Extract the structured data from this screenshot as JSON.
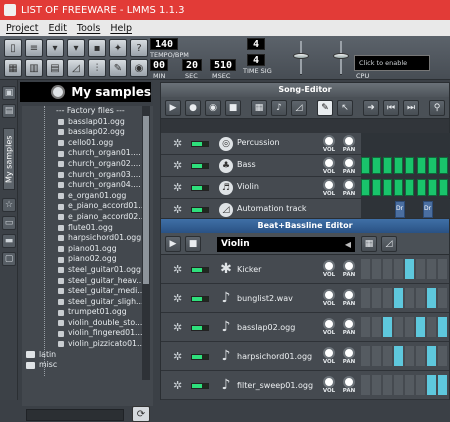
{
  "window": {
    "title": "LIST OF FREEWARE - LMMS 1.1.3"
  },
  "menu": [
    "Project",
    "Edit",
    "Tools",
    "Help"
  ],
  "toolbar": {
    "tempo_label": "TEMPO/BPM",
    "tempo_value": "140",
    "min_label": "MIN",
    "min_value": "00",
    "sec_label": "SEC",
    "sec_value": "20",
    "msec_label": "MSEC",
    "msec_value": "510",
    "timesig_label": "TIME SIG",
    "timesig_top": "4",
    "timesig_bottom": "4",
    "cpu_text": "Click to enable",
    "cpu_label": "CPU"
  },
  "sidebar": {
    "tab_label": "My samples"
  },
  "browser": {
    "title": "My samples",
    "header_row": "--- Factory files ---",
    "files": [
      "basslap01.ogg",
      "basslap02.ogg",
      "cello01.ogg",
      "church_organ01....",
      "church_organ02....",
      "church_organ03....",
      "church_organ04....",
      "e_organ01.ogg",
      "e_piano_accord01...",
      "e_piano_accord02...",
      "flute01.ogg",
      "harpsichord01.ogg",
      "piano01.ogg",
      "piano02.ogg",
      "steel_guitar01.ogg",
      "steel_guitar_heav...",
      "steel_guitar_medi...",
      "steel_guitar_sligh...",
      "trumpet01.ogg",
      "violin_double_sto...",
      "violin_fingered01...",
      "violin_pizzicato01..."
    ],
    "folders": [
      "latin",
      "misc"
    ]
  },
  "song_editor": {
    "title": "Song-Editor",
    "vol_label": "VOL",
    "pan_label": "PAN",
    "tracks": [
      {
        "name": "Percussion",
        "icon": "percussion-icon"
      },
      {
        "name": "Bass",
        "icon": "bass-icon"
      },
      {
        "name": "Violin",
        "icon": "violin-icon"
      },
      {
        "name": "Automation track",
        "icon": "automation-icon"
      }
    ],
    "pattern_labels": [
      "Dr",
      "Dr"
    ]
  },
  "bb_editor": {
    "title": "Beat+Bassline Editor",
    "selected": "Violin",
    "vol_label": "VOL",
    "pan_label": "PAN",
    "tracks": [
      {
        "name": "Kicker",
        "icon": "kicker-icon",
        "steps": [
          0,
          0,
          0,
          0,
          1,
          0,
          0,
          0
        ]
      },
      {
        "name": "bunglist2.wav",
        "icon": "note-icon",
        "steps": [
          0,
          0,
          0,
          1,
          0,
          0,
          1,
          0
        ]
      },
      {
        "name": "basslap02.ogg",
        "icon": "note-icon",
        "steps": [
          0,
          0,
          1,
          0,
          0,
          1,
          0,
          1
        ]
      },
      {
        "name": "harpsichord01.ogg",
        "icon": "note-icon",
        "steps": [
          0,
          0,
          0,
          1,
          0,
          0,
          1,
          0
        ]
      },
      {
        "name": "filter_sweep01.ogg",
        "icon": "note-icon",
        "steps": [
          0,
          0,
          0,
          0,
          0,
          0,
          1,
          1
        ]
      }
    ]
  },
  "colors": {
    "accent_title": "#e23b37",
    "pattern_green": "#19c46b",
    "step_on": "#5ec8dd",
    "bb_title": "#2a5284"
  }
}
